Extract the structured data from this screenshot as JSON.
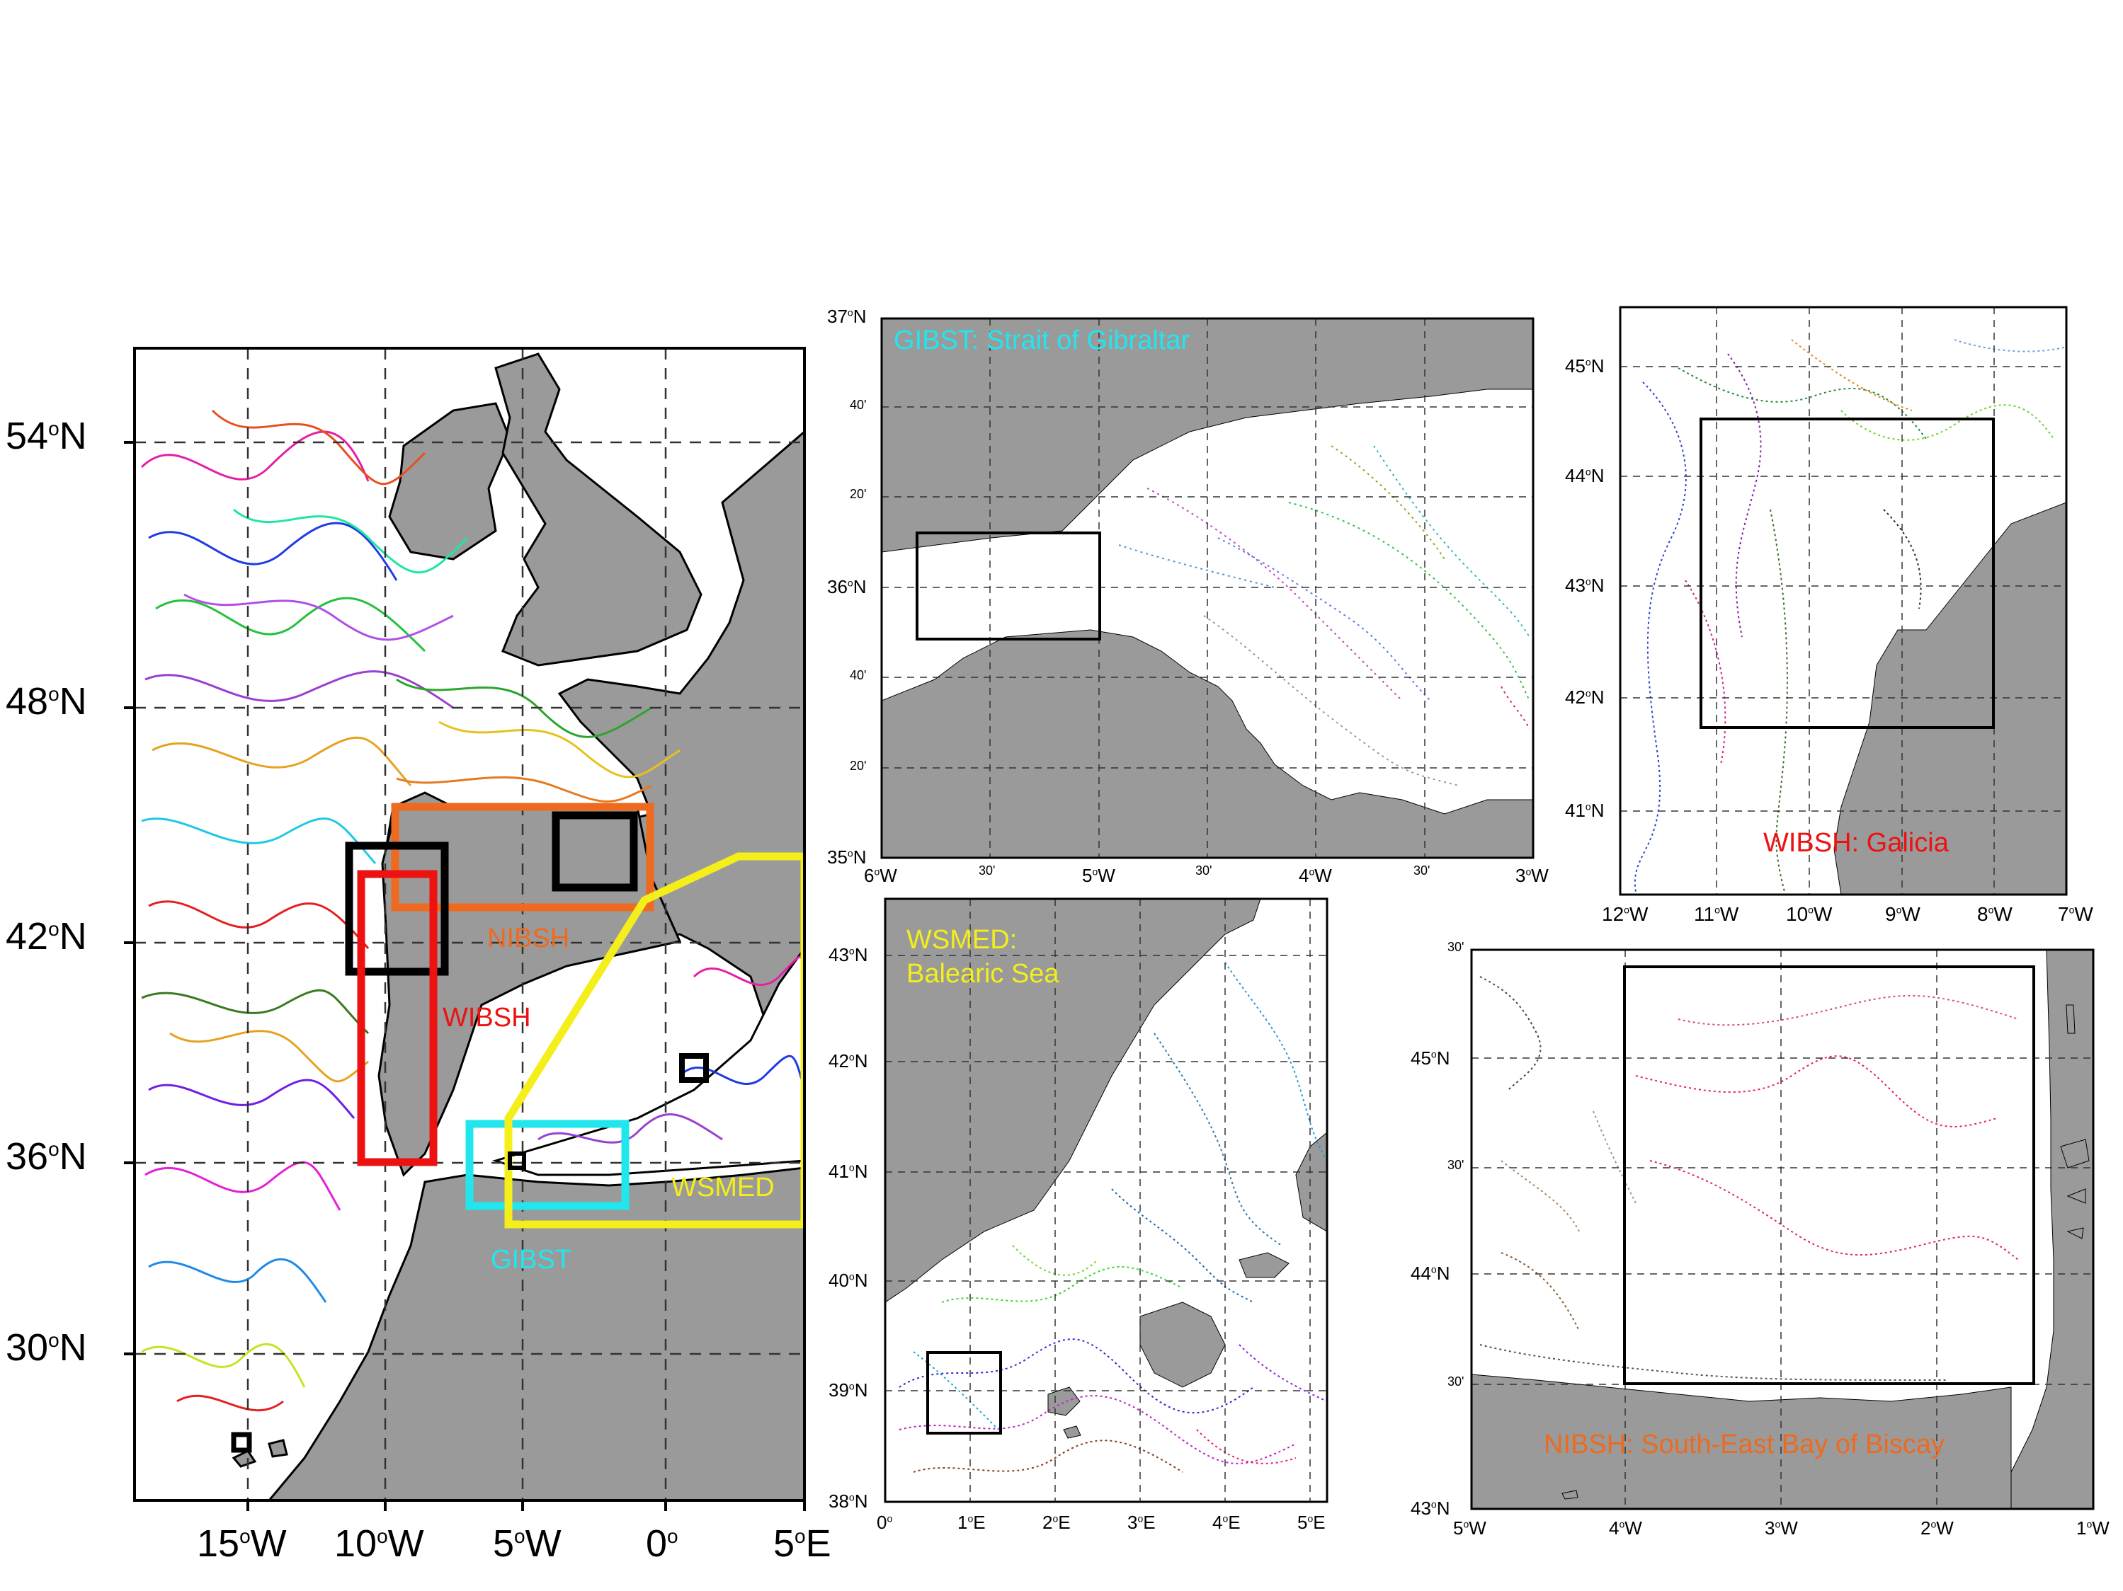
{
  "colors": {
    "land": "#9a9a9a",
    "sea": "#ffffff",
    "frame": "#000000",
    "grid": "#555555",
    "nibsh": "#ee6a1f",
    "wibsh": "#ee1111",
    "gibst": "#22e6ee",
    "wsmed": "#f4ee1a",
    "subbox": "#000000"
  },
  "main_map": {
    "lat_labels": [
      {
        "deg": "54",
        "hemi": "N"
      },
      {
        "deg": "48",
        "hemi": "N"
      },
      {
        "deg": "42",
        "hemi": "N"
      },
      {
        "deg": "36",
        "hemi": "N"
      },
      {
        "deg": "30",
        "hemi": "N"
      }
    ],
    "lon_labels": [
      {
        "deg": "15",
        "hemi": "W"
      },
      {
        "deg": "10",
        "hemi": "W"
      },
      {
        "deg": "5",
        "hemi": "W"
      },
      {
        "deg": "0",
        "hemi": ""
      },
      {
        "deg": "5",
        "hemi": "E"
      }
    ],
    "region_labels": {
      "nibsh": "NIBSH",
      "wibsh": "WIBSH",
      "gibst": "GIBST",
      "wsmed": "WSMED"
    }
  },
  "gibraltar_panel": {
    "title": "GIBST: Strait of Gibraltar",
    "lat_labels": [
      "37",
      "40'",
      "20'",
      "36",
      "40'",
      "20'",
      "35"
    ],
    "lat_hemi": "N",
    "lon_labels": [
      "6",
      "30'",
      "5",
      "30'",
      "4",
      "30'",
      "3"
    ],
    "lon_hemi": "W"
  },
  "galicia_panel": {
    "title": "WIBSH: Galicia",
    "lat_labels": [
      "45",
      "44",
      "43",
      "42",
      "41"
    ],
    "lat_hemi": "N",
    "lon_labels": [
      "12",
      "11",
      "10",
      "9",
      "8",
      "7"
    ],
    "lon_hemi": "W"
  },
  "balearic_panel": {
    "title_line1": "WSMED:",
    "title_line2": "Balearic Sea",
    "lat_labels": [
      "43",
      "42",
      "41",
      "40",
      "39",
      "38"
    ],
    "lat_hemi": "N",
    "lon_labels": [
      "0",
      "1",
      "2",
      "3",
      "4",
      "5"
    ],
    "lon_hemi": "E"
  },
  "biscay_panel": {
    "title": "NIBSH: South-East Bay of Biscay",
    "lat_labels": [
      "30'",
      "45",
      "30'",
      "44",
      "30'",
      "43"
    ],
    "lat_hemi": "N",
    "lon_labels": [
      "5",
      "4",
      "3",
      "2",
      "1"
    ],
    "lon_hemi": "W"
  }
}
